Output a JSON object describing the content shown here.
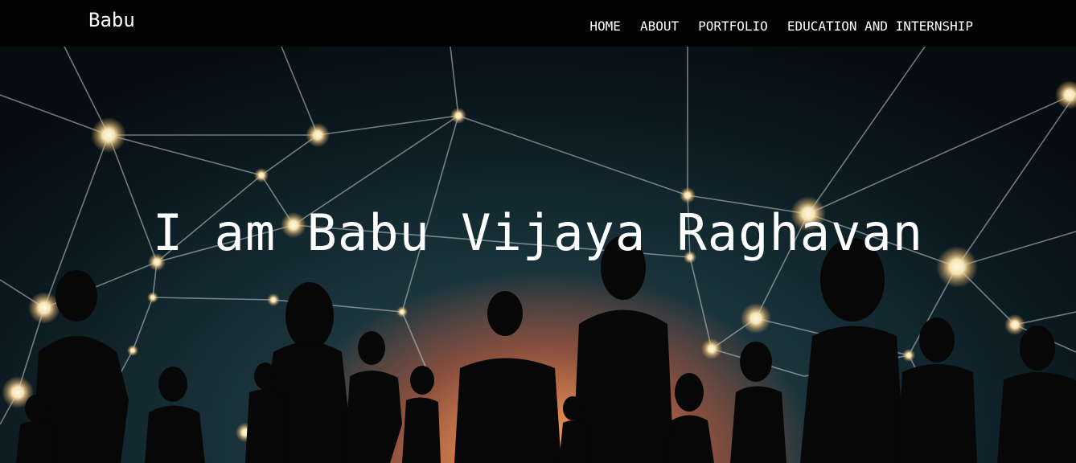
{
  "navbar": {
    "brand": "Babu",
    "links": [
      {
        "label": "HOME"
      },
      {
        "label": "ABOUT"
      },
      {
        "label": "PORTFOLIO"
      },
      {
        "label": "EDUCATION AND INTERNSHIP"
      }
    ]
  },
  "hero": {
    "title": "I am Babu Vijaya Raghavan",
    "background_image": "network-crowd-silhouette"
  },
  "colors": {
    "navbar_bg": "#030303",
    "text": "#ffffff",
    "glow": "#f7b46c"
  }
}
